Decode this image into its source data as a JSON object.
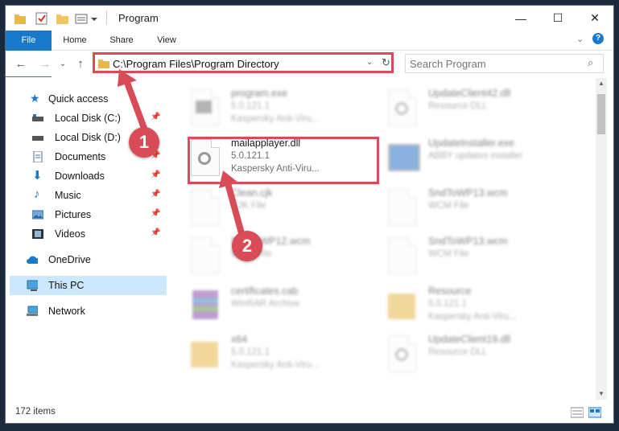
{
  "window": {
    "title": "Program",
    "controls": {
      "minimize": "—",
      "maximize": "☐",
      "close": "✕"
    }
  },
  "ribbon": {
    "tabs": [
      "File",
      "Home",
      "Share",
      "View"
    ]
  },
  "address": {
    "path": "C:\\Program Files\\Program Directory",
    "search_placeholder": "Search Program"
  },
  "nav": {
    "items": [
      {
        "label": "Quick access",
        "icon": "star-icon",
        "pinned": false
      },
      {
        "label": "Local Disk (C:)",
        "icon": "drive-icon",
        "pinned": true
      },
      {
        "label": "Local Disk (D:)",
        "icon": "drive-icon",
        "pinned": false
      },
      {
        "label": "Documents",
        "icon": "documents-icon",
        "pinned": true
      },
      {
        "label": "Downloads",
        "icon": "download-icon",
        "pinned": true
      },
      {
        "label": "Music",
        "icon": "music-icon",
        "pinned": true
      },
      {
        "label": "Pictures",
        "icon": "pictures-icon",
        "pinned": true
      },
      {
        "label": "Videos",
        "icon": "videos-icon",
        "pinned": true
      },
      {
        "label": "OneDrive",
        "icon": "cloud-icon",
        "pinned": false
      },
      {
        "label": "This PC",
        "icon": "computer-icon",
        "pinned": false,
        "selected": true
      },
      {
        "label": "Network",
        "icon": "network-icon",
        "pinned": false
      }
    ]
  },
  "files": [
    {
      "name": "program.exe",
      "l2": "5.0.121.1",
      "l3": "Kaspersky Anti-Viru...",
      "blur": true
    },
    {
      "name": "UpdateClient42.dll",
      "l2": "Resource DLL",
      "l3": "",
      "blur": true
    },
    {
      "name": "mailapplayer.dll",
      "l2": "5.0.121.1",
      "l3": "Kaspersky Anti-Viru...",
      "blur": false
    },
    {
      "name": "UpdateInstaller.exe",
      "l2": "ABBY updates installer",
      "l3": "",
      "blur": true
    },
    {
      "name": "Clean.cjk",
      "l2": "CJK File",
      "l3": "",
      "blur": true
    },
    {
      "name": "SndToWP13.wcm",
      "l2": "WCM File",
      "l3": "",
      "blur": true
    },
    {
      "name": "SndToWP12.wcm",
      "l2": "WCM File",
      "l3": "",
      "blur": true
    },
    {
      "name": "SndToWP13.wcm",
      "l2": "WCM File",
      "l3": "",
      "blur": true
    },
    {
      "name": "certificates.cab",
      "l2": "WinRAR Archive",
      "l3": "",
      "blur": true
    },
    {
      "name": "Resource",
      "l2": "5.0.121.1",
      "l3": "Kaspersky Anti-Viru...",
      "blur": true
    },
    {
      "name": "x64",
      "l2": "5.0.121.1",
      "l3": "Kaspersky Anti-Viru...",
      "blur": true
    },
    {
      "name": "UpdateClient19.dll",
      "l2": "Resource DLL",
      "l3": "",
      "blur": true
    }
  ],
  "status": {
    "items": "172 items"
  },
  "callouts": [
    "1",
    "2"
  ],
  "colors": {
    "accent": "#1979ca",
    "highlight": "#d94c57",
    "selected_nav": "#cce8ff"
  }
}
